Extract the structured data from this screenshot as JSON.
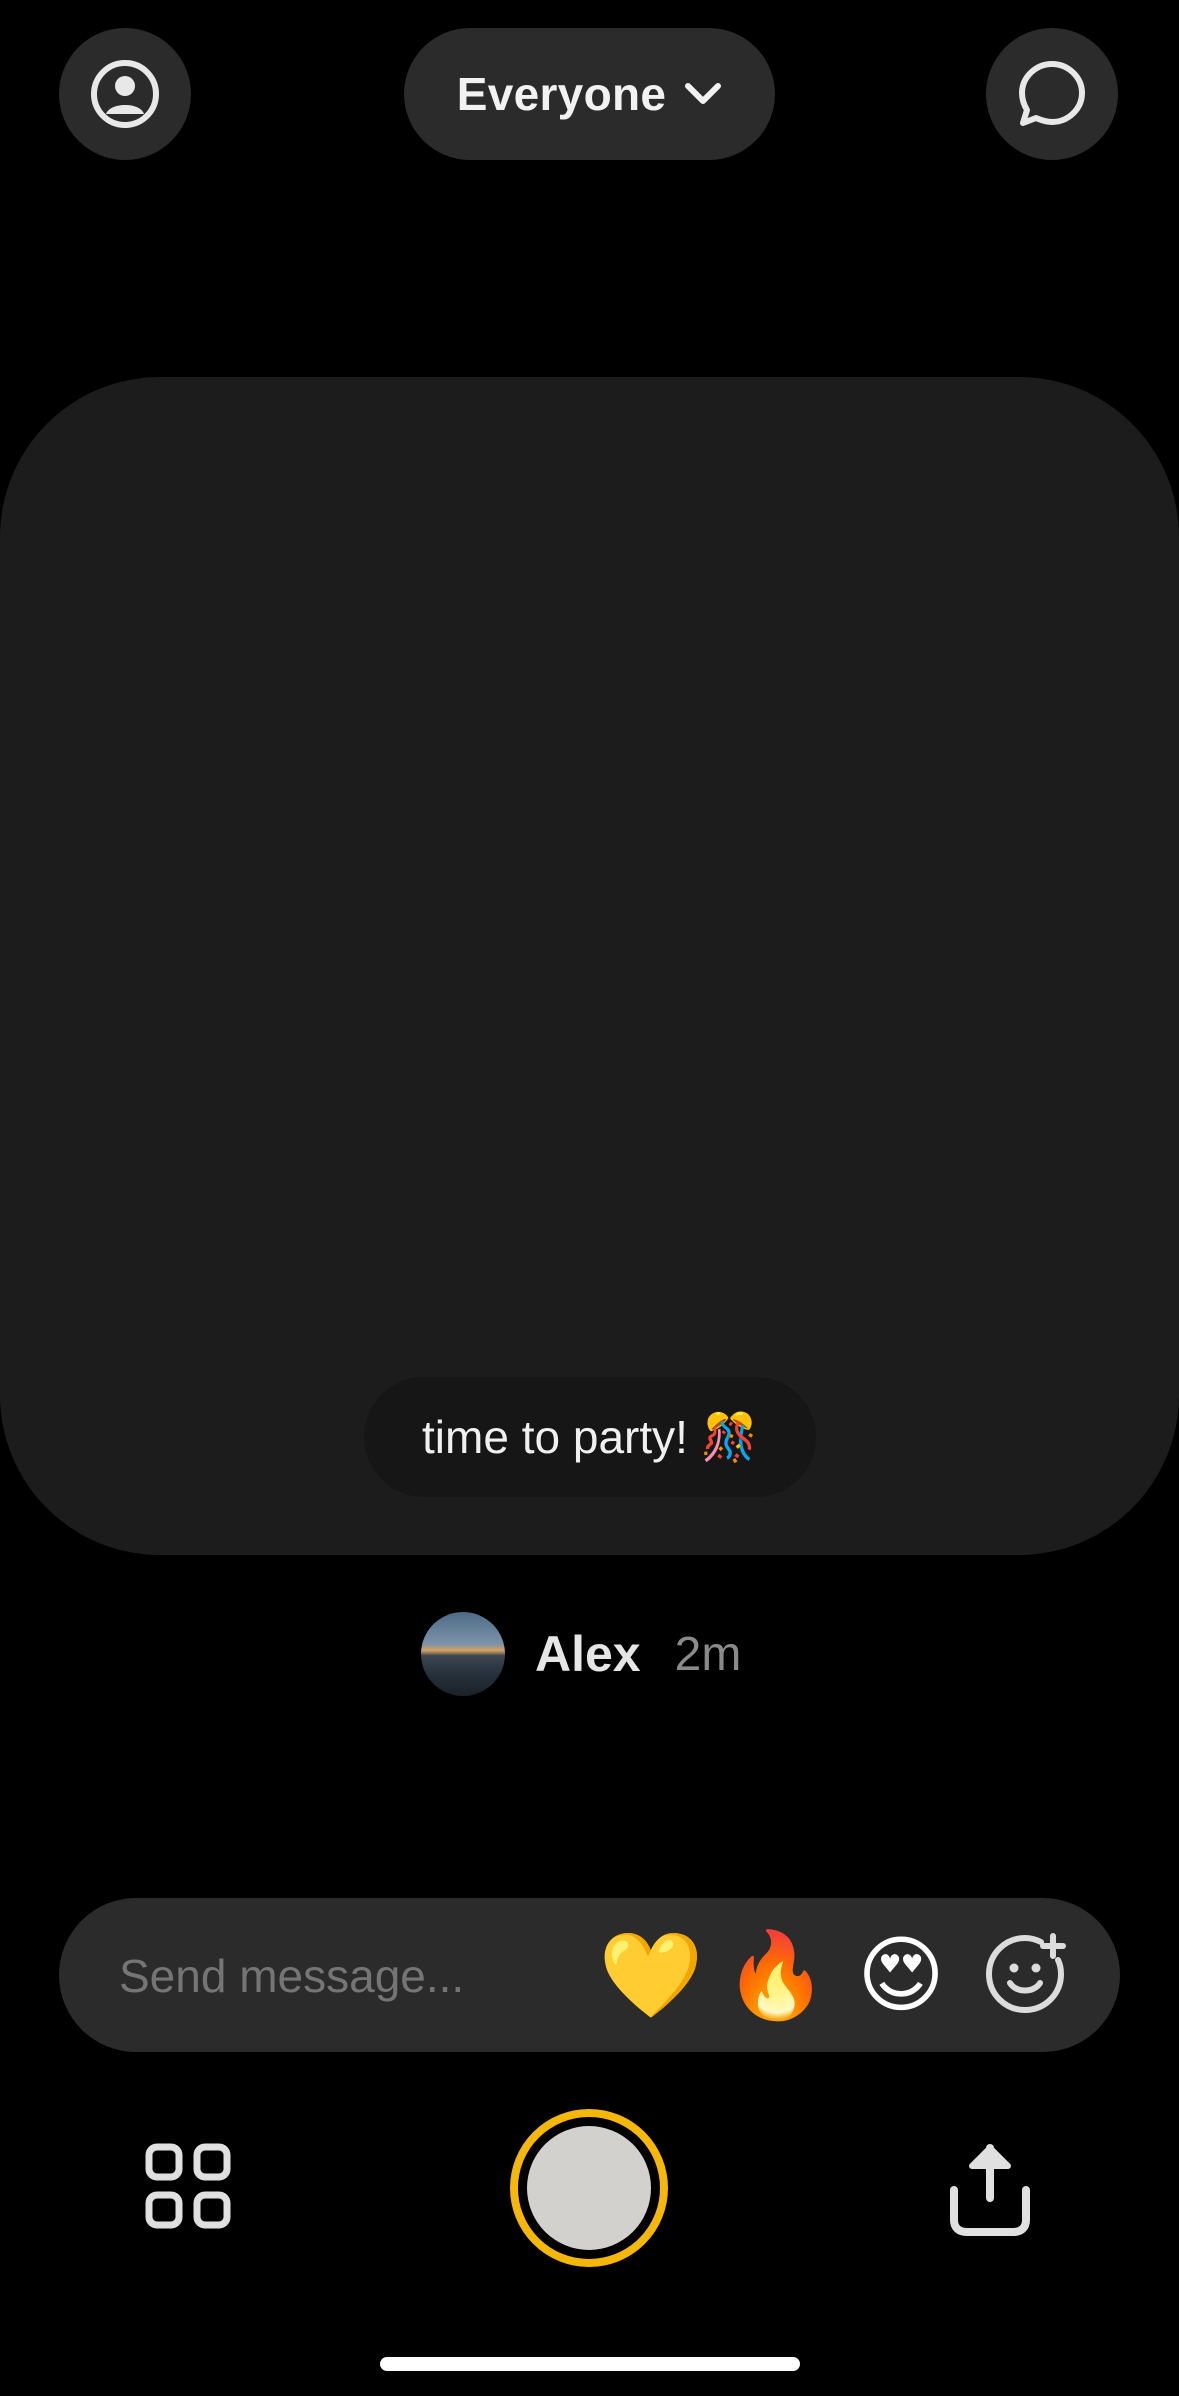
{
  "header": {
    "profile_icon": "person-circle-icon",
    "audience_label": "Everyone",
    "audience_chevron_icon": "chevron-down-icon",
    "chat_icon": "chat-bubble-icon"
  },
  "post": {
    "caption": "time to party! 🎊",
    "author_name": "Alex",
    "time_ago": "2m"
  },
  "message_bar": {
    "placeholder": "Send message...",
    "reactions": [
      "💛",
      "🔥",
      "😍"
    ],
    "add_reaction_icon": "add-emoji-icon"
  },
  "footer": {
    "grid_icon": "grid-icon",
    "share_icon": "share-upload-icon"
  },
  "colors": {
    "background": "#000000",
    "surface": "#2b2b2b",
    "card": "#1c1c1c",
    "shutter_ring": "#f5b70a",
    "shutter_fill": "#d2d1cd"
  }
}
